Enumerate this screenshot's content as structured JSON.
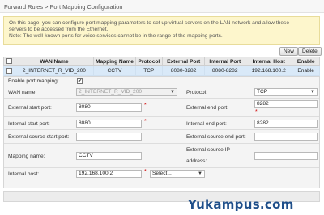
{
  "breadcrumb": "Forward Rules > Port Mapping Configuration",
  "info": {
    "line1": "On this page, you can configure port mapping parameters to set up virtual servers on the LAN network and allow these",
    "line2": "servers to be accessed from the Ethernet.",
    "line3": "Note: The well-known ports for voice services cannot be in the range of the mapping ports."
  },
  "buttons": {
    "new": "New",
    "delete": "Delete"
  },
  "table": {
    "headers": [
      "",
      "WAN Name",
      "Mapping Name",
      "Protocol",
      "External Port",
      "Internal Port",
      "Internal Host",
      "Enable"
    ],
    "row": {
      "wan_name": "2_INTERNET_R_VID_200",
      "mapping_name": "CCTV",
      "protocol": "TCP",
      "external_port": "8080-8282",
      "internal_port": "8080-8282",
      "internal_host": "192.168.100.2",
      "enable": "Enable"
    }
  },
  "form": {
    "enable_label": "Enable port mapping:",
    "enable_check": "✔",
    "wan_name_label": "WAN name:",
    "wan_name_value": "2_INTERNET_R_VID_200",
    "protocol_label": "Protocol:",
    "protocol_value": "TCP",
    "ext_start_label": "External start port:",
    "ext_start_value": "8080",
    "ext_end_label": "External end port:",
    "ext_end_value": "8282",
    "int_start_label": "Internal start port:",
    "int_start_value": "8080",
    "int_end_label": "Internal end port:",
    "int_end_value": "8282",
    "ext_src_start_label": "External source start port:",
    "ext_src_start_value": "",
    "ext_src_end_label": "External source end port:",
    "ext_src_end_value": "",
    "mapping_name_label": "Mapping name:",
    "mapping_name_value": "CCTV",
    "ext_src_ip_label_1": "External source IP",
    "ext_src_ip_label_2": "address:",
    "ext_src_ip_value": "",
    "internal_host_label": "Internal host:",
    "internal_host_value": "192.168.100.2",
    "internal_host_select": "Select...",
    "required_mark": "*",
    "arrow": "▼"
  },
  "watermark": "Yukampus.com"
}
